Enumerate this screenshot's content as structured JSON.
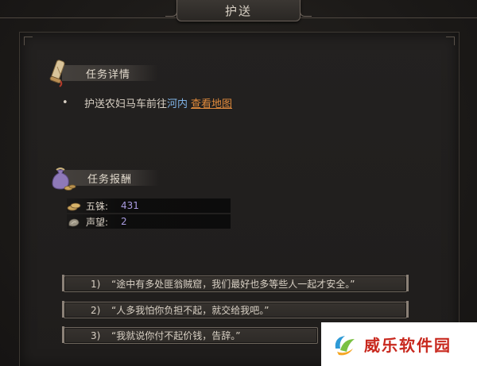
{
  "window": {
    "title": "护送"
  },
  "task_detail": {
    "heading": "任务详情",
    "bullet": "•",
    "text_prefix": "护送农妇马车前往",
    "destination": "河内",
    "map_link": "查看地图"
  },
  "rewards": {
    "heading": "任务报酬",
    "items": [
      {
        "label": "五铢:",
        "value": "431",
        "icon": "coins-icon"
      },
      {
        "label": "声望:",
        "value": "2",
        "icon": "reputation-icon"
      }
    ]
  },
  "options": [
    {
      "num": "1)",
      "text": "“途中有多处匪翁贼窟，我们最好也多等些人一起才安全。”"
    },
    {
      "num": "2)",
      "text": "“人多我怕你负担不起，就交给我吧。”"
    },
    {
      "num": "3)",
      "text": "“我就说你付不起价钱，告辞。”"
    }
  ],
  "watermark": {
    "text": "威乐软件园"
  },
  "colors": {
    "background": "#1e1c1a",
    "place_highlight": "#7fb3e6",
    "link": "#e08a3c",
    "reward_value": "#a99be0",
    "watermark_text": "#c8281e"
  }
}
